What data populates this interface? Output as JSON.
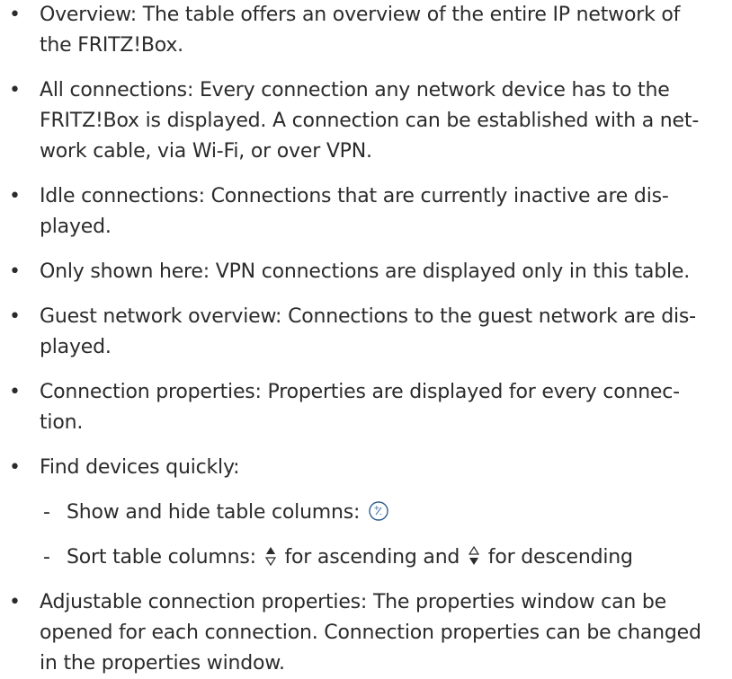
{
  "items": [
    "Overview: The table offers an overview of the entire IP network of the FRITZ!Box.",
    "All connections: Every connection any network device has to the FRITZ!Box is displayed. A connection can be established with a network cable, via Wi-Fi, or over VPN.",
    "Idle connections: Connections that are currently inactive are displayed.",
    "Only shown here: VPN connections are displayed only in this table.",
    "Guest network overview: Connections to the guest network are displayed.",
    "Connection properties: Properties are displayed for every connection.",
    "Find devices quickly:",
    "Adjustable connection properties: The properties window can be opened for each connection. Connection properties can be changed in the properties window."
  ],
  "subitems": {
    "show_hide": "Show and hide table columns:",
    "sort_prefix": "Sort table columns:",
    "sort_asc": "for ascending and",
    "sort_desc": "for descending"
  },
  "icons": {
    "toggle": "plus-minus-circle-icon",
    "sort_ascending": "sort-ascending-icon",
    "sort_descending": "sort-descending-icon",
    "icon_color": "#2f5f8f"
  }
}
